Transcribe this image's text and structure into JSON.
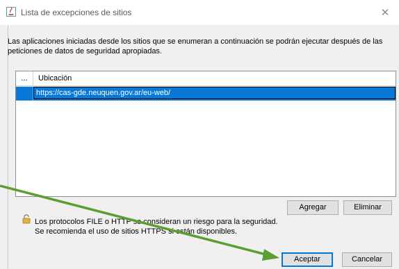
{
  "window": {
    "title": "Lista de excepciones de sitios",
    "close_glyph": "✕"
  },
  "description": "Las aplicaciones iniciadas desde los sitios que se enumeran a continuación se podrán ejecutar después de las peticiones de datos de seguridad apropiadas.",
  "table": {
    "columns": [
      "...",
      "Ubicación"
    ],
    "rows": [
      {
        "location": "https://cas-gde.neuquen.gov.ar/eu-web/",
        "selected": true
      }
    ]
  },
  "table_buttons": {
    "add": "Agregar",
    "remove": "Eliminar"
  },
  "warning": {
    "line1": "Los protocolos FILE o HTTP se consideran un riesgo para la seguridad.",
    "line2": "Se recomienda el uso de sitios HTTPS si están disponibles."
  },
  "dialog_buttons": {
    "ok": "Aceptar",
    "cancel": "Cancelar"
  },
  "icons": {
    "title": "java-icon",
    "warning": "lock-icon"
  },
  "colors": {
    "selection": "#0a78d7",
    "annotation_arrow": "#5c9e32"
  }
}
